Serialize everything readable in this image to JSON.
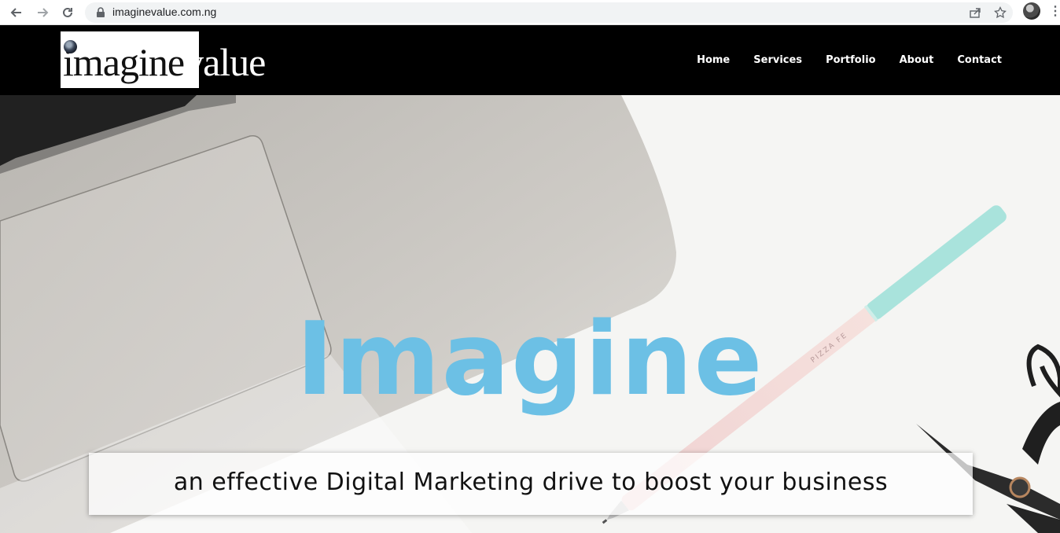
{
  "browser": {
    "url": "imaginevalue.com.ng"
  },
  "site": {
    "logo": {
      "part1": "imagine",
      "part2": "value"
    },
    "nav": [
      "Home",
      "Services",
      "Portfolio",
      "About",
      "Contact"
    ]
  },
  "hero": {
    "title": "Imagine",
    "tagline": "an effective Digital Marketing drive to boost your business",
    "title_color": "#6cc0e5",
    "pen_print": "PIZZA FE"
  }
}
